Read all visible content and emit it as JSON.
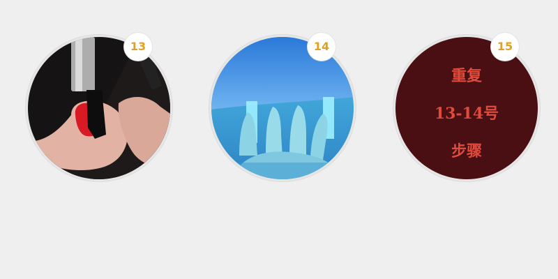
{
  "steps": [
    {
      "number": "13",
      "image": "brush-applying-red-nail-polish"
    },
    {
      "number": "14",
      "image": "hand-under-uv-nail-lamp"
    },
    {
      "number": "15",
      "lines": [
        "重复",
        "13-14号",
        "步骤"
      ]
    }
  ],
  "colors": {
    "background": "#efefef",
    "badge_text": "#e1a11f",
    "step15_circle": "#4a0f12",
    "step15_text": "#e04b3c"
  }
}
